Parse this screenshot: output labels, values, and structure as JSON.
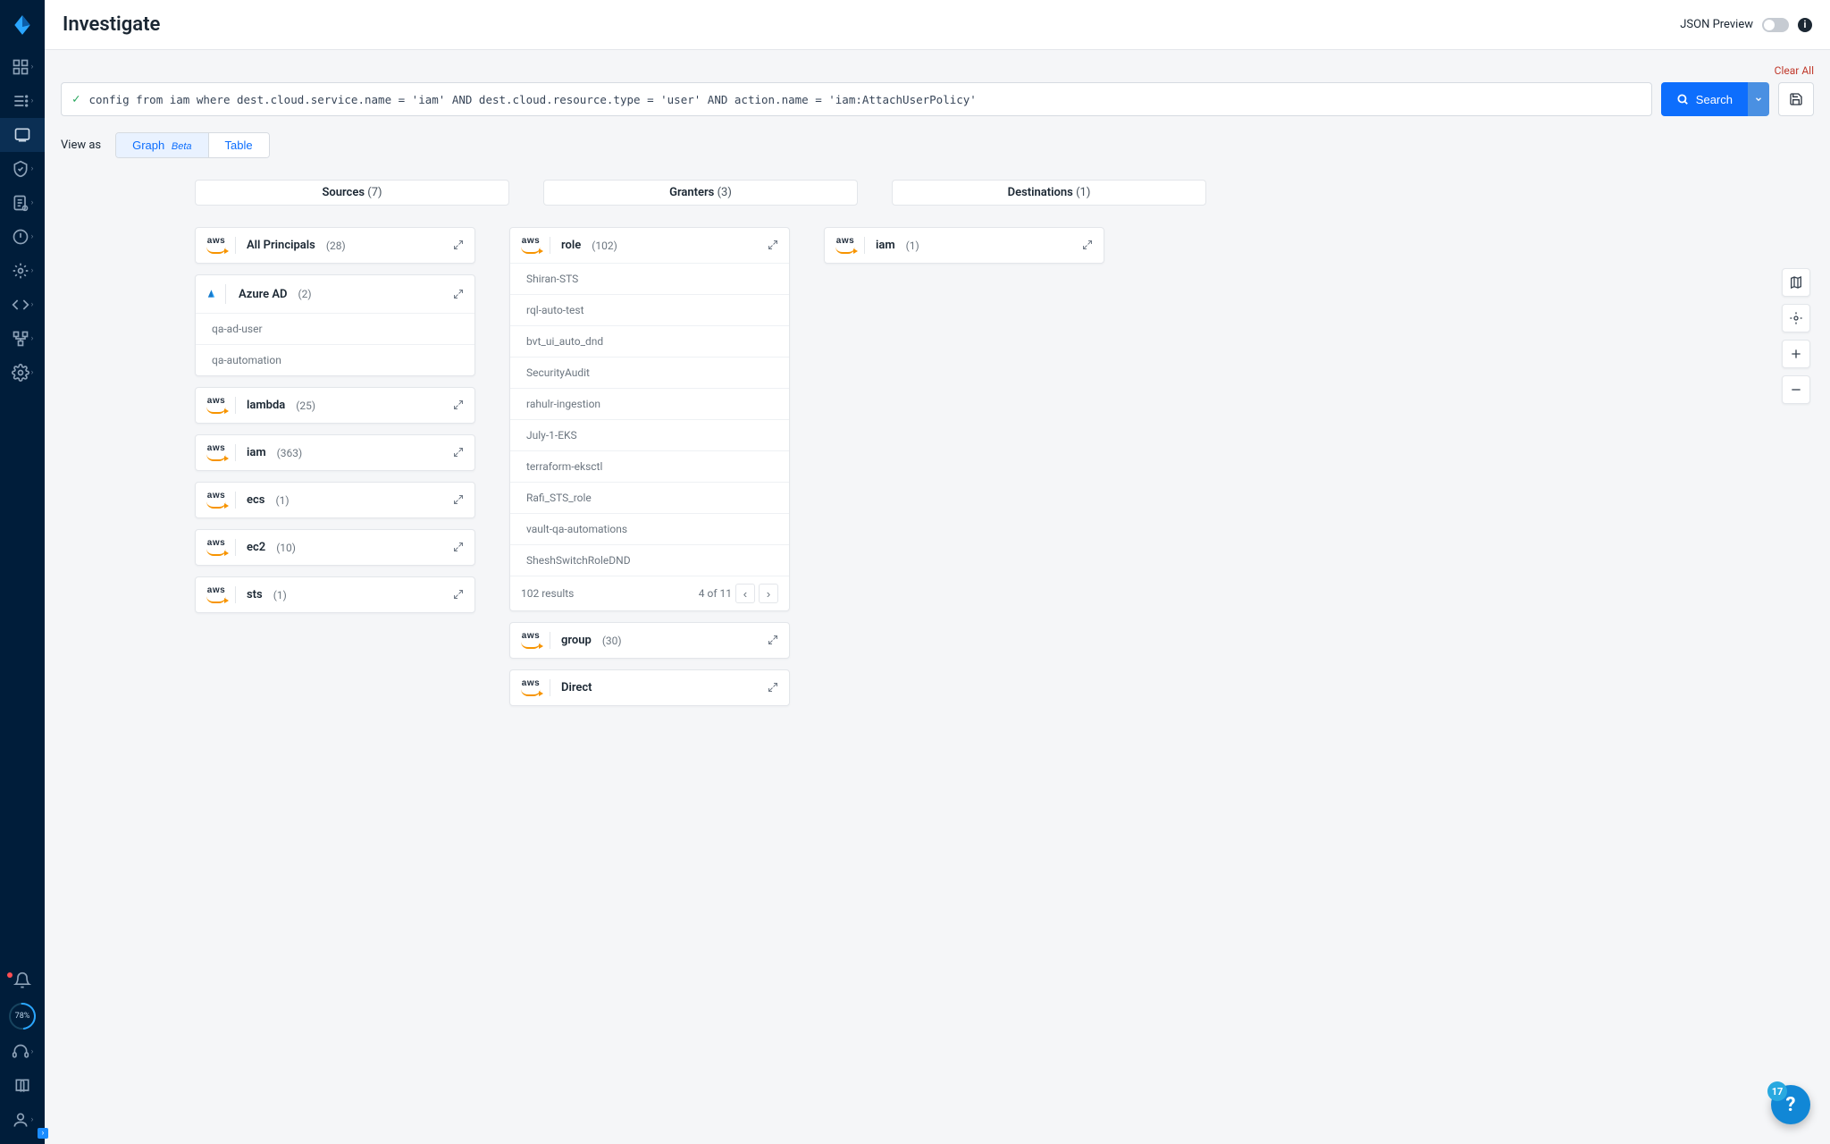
{
  "header": {
    "title": "Investigate",
    "json_preview_label": "JSON Preview"
  },
  "toolbar": {
    "clear_all": "Clear All",
    "query": "config from iam where dest.cloud.service.name = 'iam' AND dest.cloud.resource.type = 'user' AND action.name = 'iam:AttachUserPolicy'",
    "search_label": "Search"
  },
  "view_as": {
    "label": "View as",
    "graph": "Graph",
    "graph_badge": "Beta",
    "table": "Table"
  },
  "columns": {
    "sources": {
      "label": "Sources",
      "count": "(7)"
    },
    "granters": {
      "label": "Granters",
      "count": "(3)"
    },
    "destinations": {
      "label": "Destinations",
      "count": "(1)"
    }
  },
  "sources": [
    {
      "provider": "aws",
      "name": "All Principals",
      "count": "(28)",
      "expanded": false
    },
    {
      "provider": "azure",
      "name": "Azure AD",
      "count": "(2)",
      "expanded": true,
      "items": [
        "qa-ad-user",
        "qa-automation"
      ]
    },
    {
      "provider": "aws",
      "name": "lambda",
      "count": "(25)",
      "expanded": false
    },
    {
      "provider": "aws",
      "name": "iam",
      "count": "(363)",
      "expanded": false
    },
    {
      "provider": "aws",
      "name": "ecs",
      "count": "(1)",
      "expanded": false
    },
    {
      "provider": "aws",
      "name": "ec2",
      "count": "(10)",
      "expanded": false
    },
    {
      "provider": "aws",
      "name": "sts",
      "count": "(1)",
      "expanded": false
    }
  ],
  "granters": [
    {
      "provider": "aws",
      "name": "role",
      "count": "(102)",
      "expanded": true,
      "items": [
        "Shiran-STS",
        "rql-auto-test",
        "bvt_ui_auto_dnd",
        "SecurityAudit",
        "rahulr-ingestion",
        "July-1-EKS",
        "terraform-eksctl",
        "Rafi_STS_role",
        "vault-qa-automations",
        "SheshSwitchRoleDND"
      ],
      "footer_results": "102 results",
      "footer_pages": "4 of 11"
    },
    {
      "provider": "aws",
      "name": "group",
      "count": "(30)",
      "expanded": false
    },
    {
      "provider": "aws",
      "name": "Direct",
      "count": "",
      "expanded": false
    }
  ],
  "destinations": [
    {
      "provider": "aws",
      "name": "iam",
      "count": "(1)",
      "expanded": false
    }
  ],
  "rail_score": "78%",
  "help_badge": "17"
}
